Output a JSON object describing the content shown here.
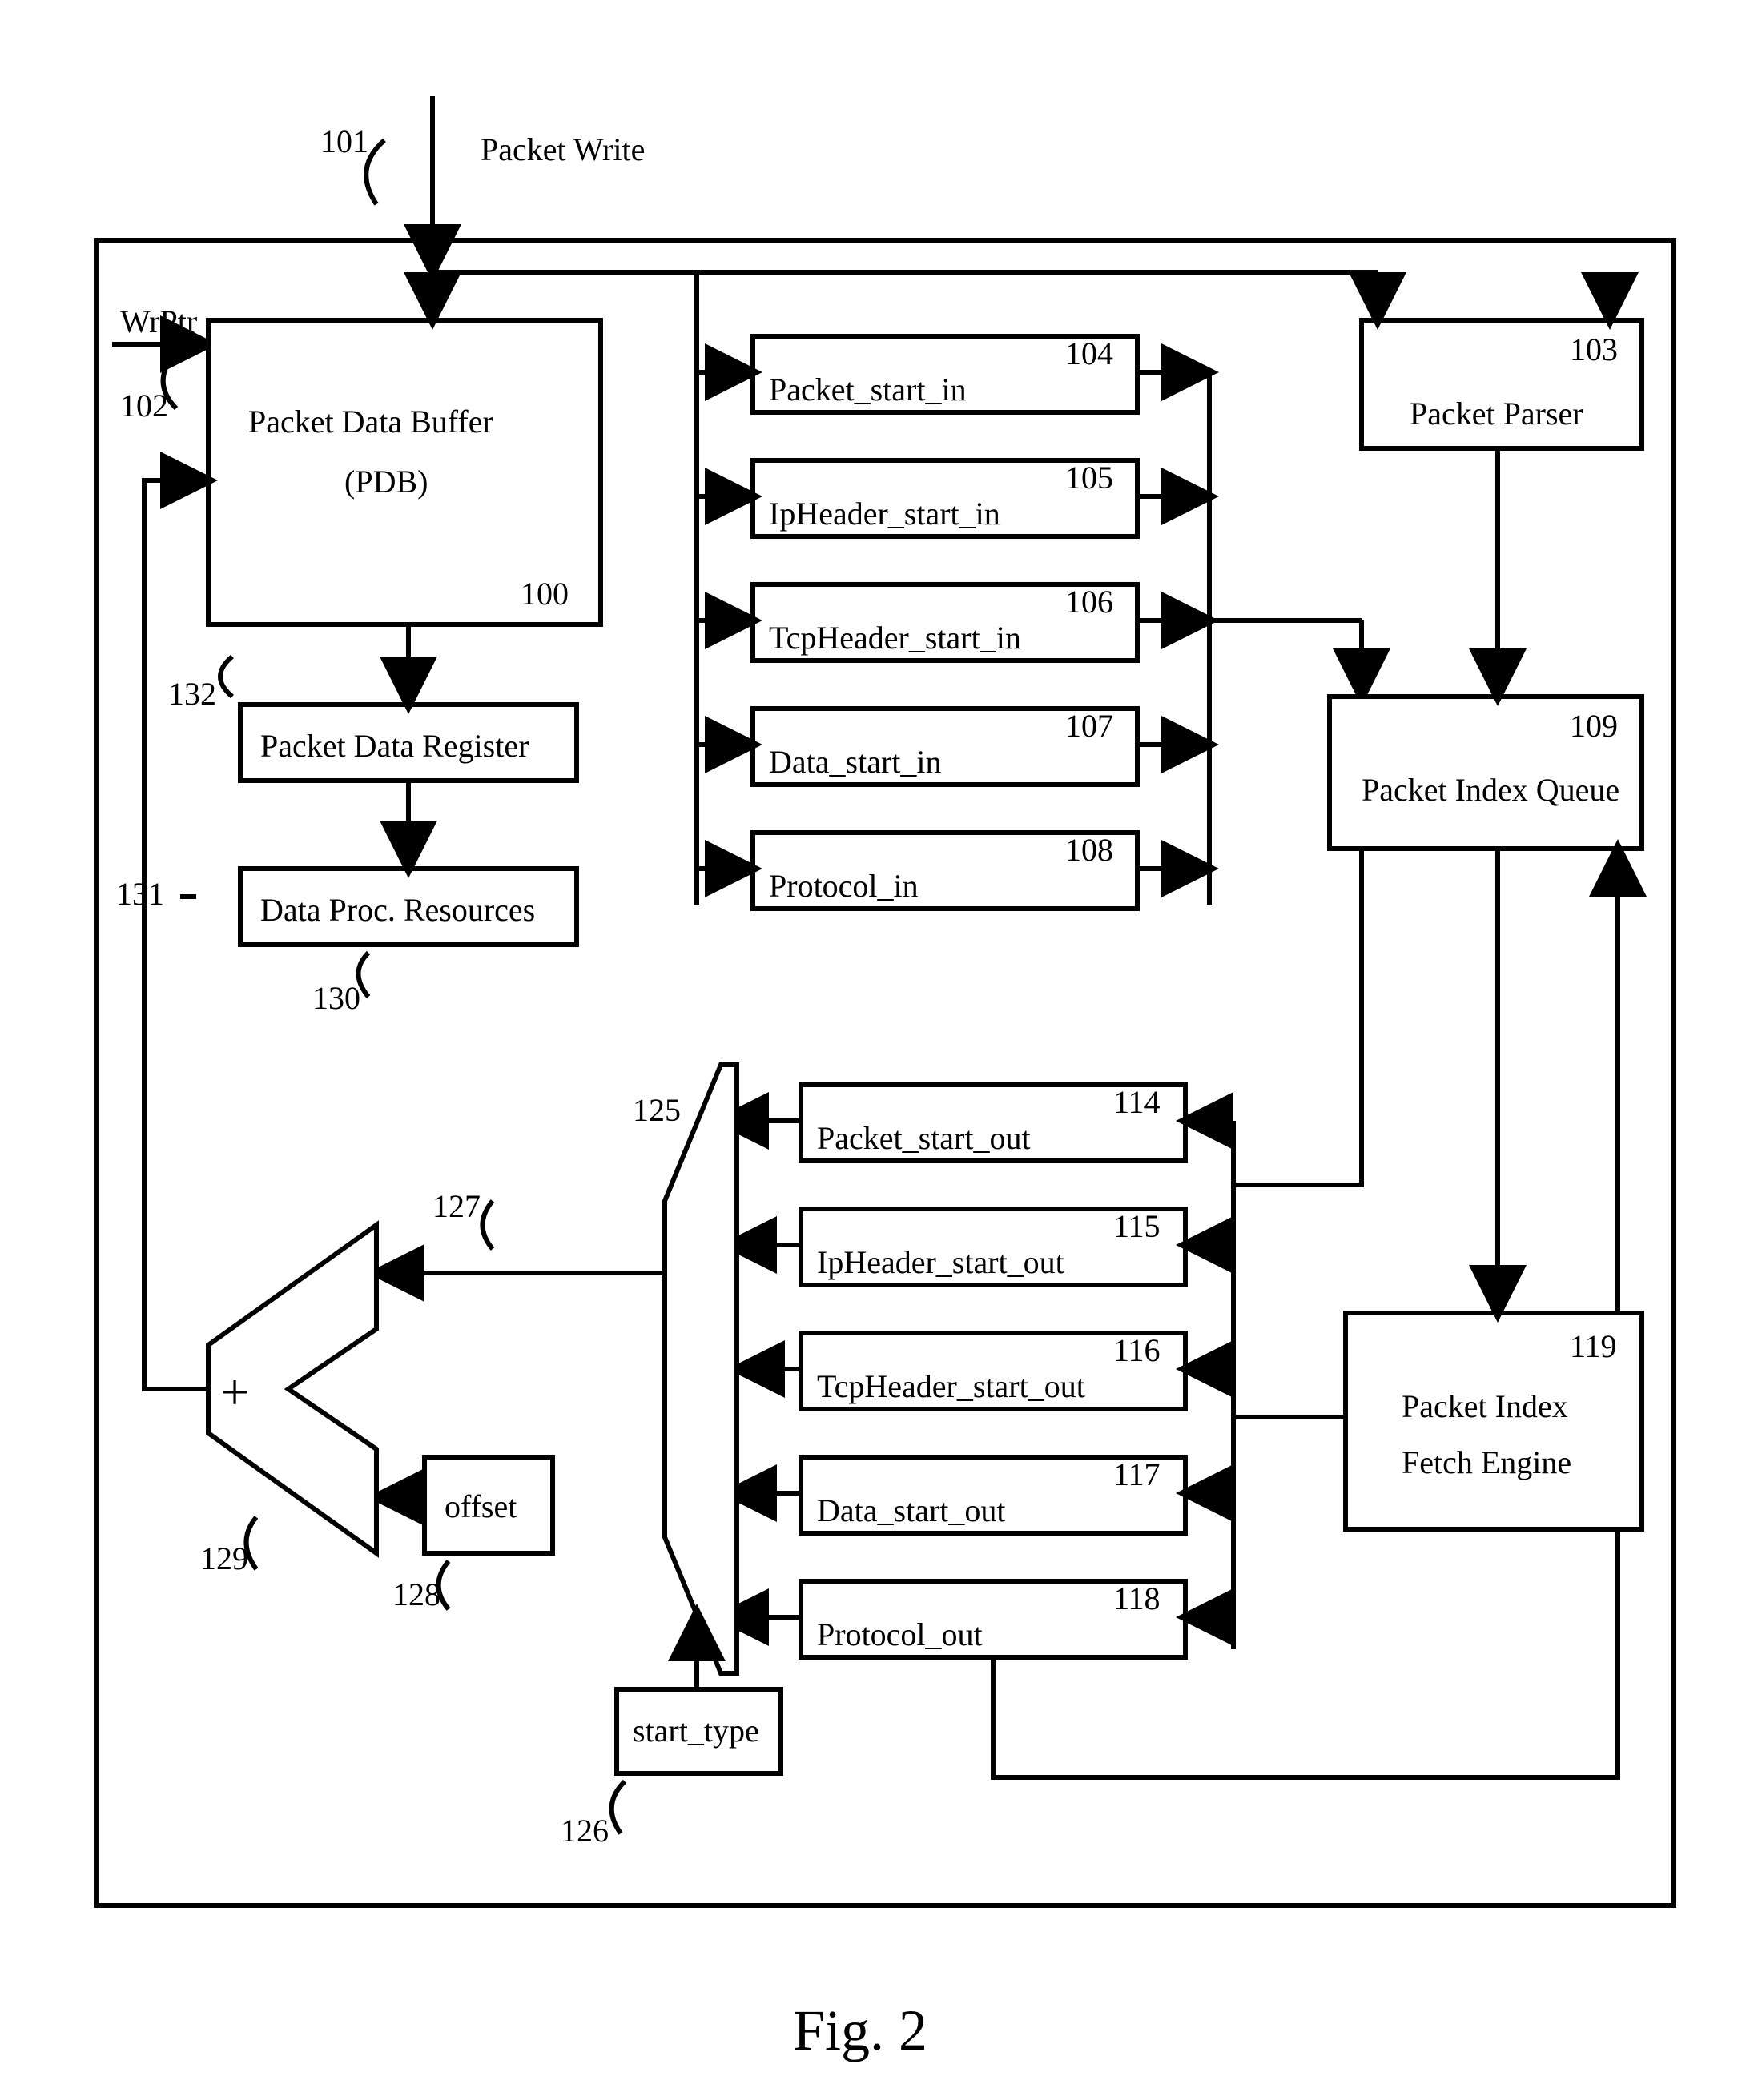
{
  "caption": "Fig. 2",
  "top_label": "Packet Write",
  "left_input": "WrPtr",
  "pdb": {
    "line1": "Packet Data Buffer",
    "line2": "(PDB)"
  },
  "pdr": "Packet Data Register",
  "dpr": "Data Proc. Resources",
  "parser": "Packet Parser",
  "piq": "Packet Index Queue",
  "pife": {
    "line1": "Packet Index",
    "line2": "Fetch Engine"
  },
  "in_regs": {
    "r1": "Packet_start_in",
    "r2": "IpHeader_start_in",
    "r3": "TcpHeader_start_in",
    "r4": "Data_start_in",
    "r5": "Protocol_in"
  },
  "out_regs": {
    "r1": "Packet_start_out",
    "r2": "IpHeader_start_out",
    "r3": "TcpHeader_start_out",
    "r4": "Data_start_out",
    "r5": "Protocol_out"
  },
  "offset": "offset",
  "start_type": "start_type",
  "plus": "+",
  "ref": {
    "n100": "100",
    "n101": "101",
    "n102": "102",
    "n103": "103",
    "n104": "104",
    "n105": "105",
    "n106": "106",
    "n107": "107",
    "n108": "108",
    "n109": "109",
    "n114": "114",
    "n115": "115",
    "n116": "116",
    "n117": "117",
    "n118": "118",
    "n119": "119",
    "n125": "125",
    "n126": "126",
    "n127": "127",
    "n128": "128",
    "n129": "129",
    "n130": "130",
    "n131": "131",
    "n132": "132"
  }
}
